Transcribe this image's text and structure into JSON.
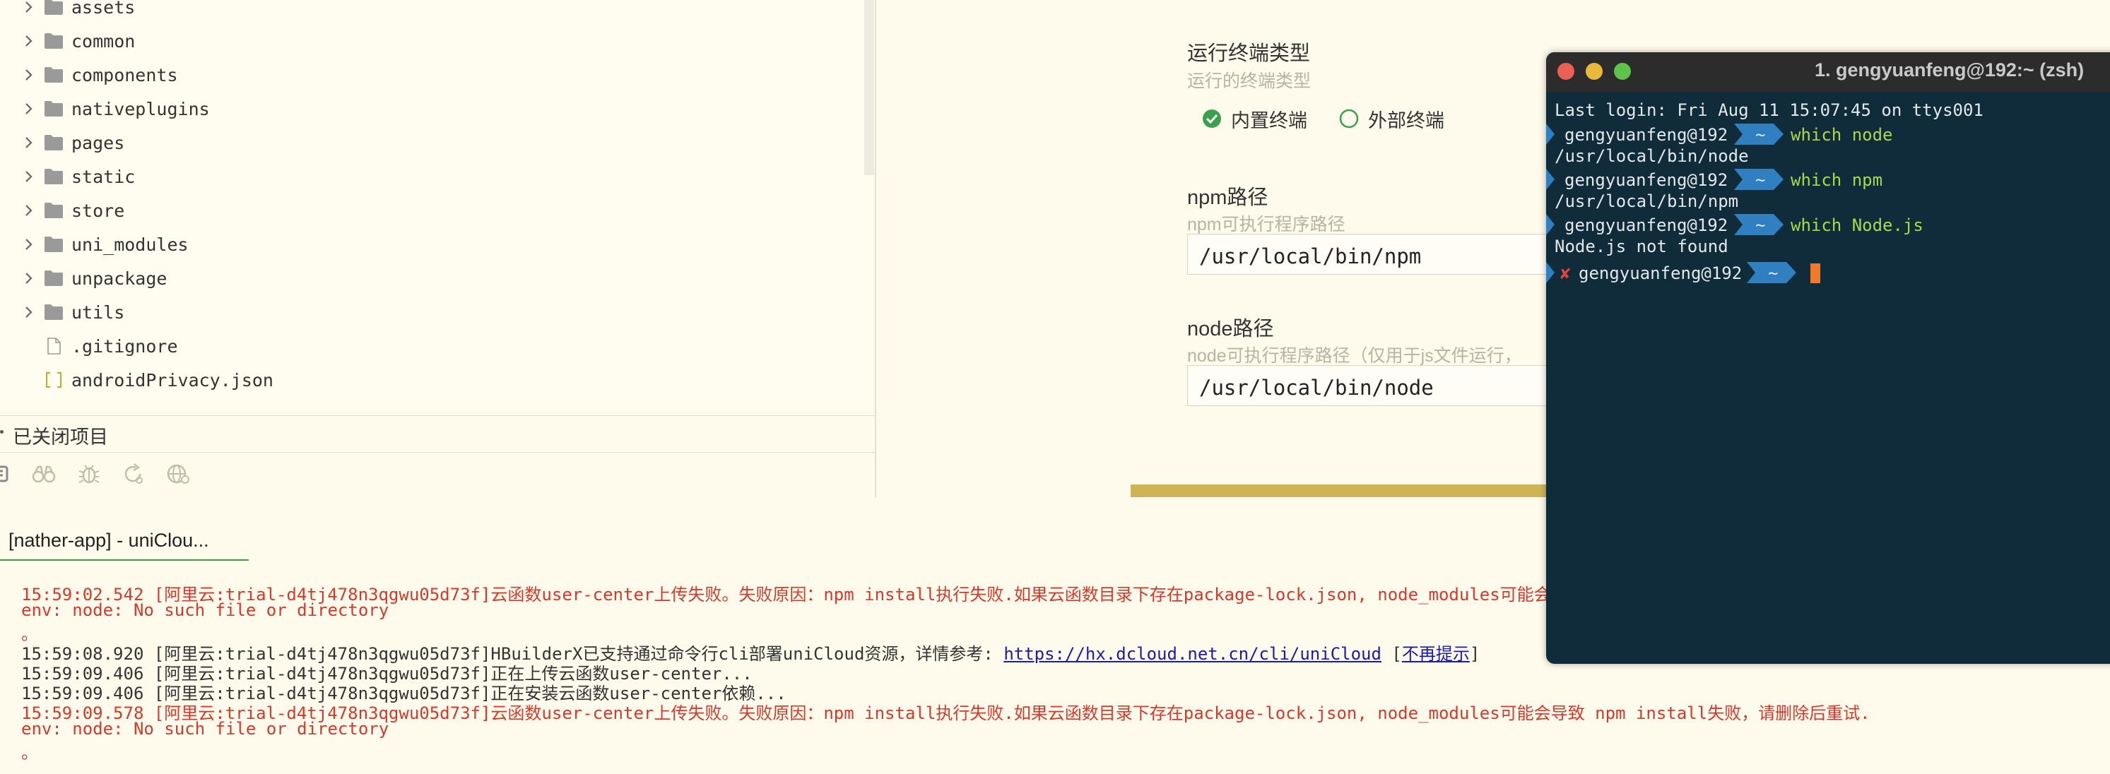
{
  "explorer": {
    "items": [
      {
        "label": "assets",
        "type": "folder"
      },
      {
        "label": "common",
        "type": "folder"
      },
      {
        "label": "components",
        "type": "folder"
      },
      {
        "label": "nativeplugins",
        "type": "folder"
      },
      {
        "label": "pages",
        "type": "folder"
      },
      {
        "label": "static",
        "type": "folder"
      },
      {
        "label": "store",
        "type": "folder"
      },
      {
        "label": "uni_modules",
        "type": "folder"
      },
      {
        "label": "unpackage",
        "type": "folder"
      },
      {
        "label": "utils",
        "type": "folder"
      },
      {
        "label": ".gitignore",
        "type": "file"
      },
      {
        "label": "androidPrivacy.json",
        "type": "json"
      }
    ],
    "closed_projects_label": "已关闭项目",
    "toolbar_icons": [
      "list-icon",
      "binoculars-icon",
      "bug-icon",
      "refresh-icon",
      "globe-icon"
    ]
  },
  "settings": {
    "terminal_type": {
      "title": "运行终端类型",
      "desc": "运行的终端类型",
      "options": [
        {
          "label": "内置终端",
          "checked": true
        },
        {
          "label": "外部终端",
          "checked": false
        }
      ]
    },
    "npm_path": {
      "title": "npm路径",
      "desc": "npm可执行程序路径",
      "value": "/usr/local/bin/npm"
    },
    "node_path": {
      "title": "node路径",
      "desc": "node可执行程序路径（仅用于js文件运行，",
      "value": "/usr/local/bin/node"
    }
  },
  "console": {
    "tab_label": "[nather-app] - uniClou...",
    "lines": [
      {
        "text": "15:59:02.542 [阿里云:trial-d4tj478n3qgwu05d73f]云函数user-center上传失败。失败原因：npm install执行失败.如果云函数目录下存在package-lock.json, node_modules可能会",
        "kind": "err"
      },
      {
        "text": "env: node: No such file or directory",
        "kind": "err"
      },
      {
        "text": "。",
        "kind": "err"
      },
      {
        "text_before": "15:59:08.920 [阿里云:trial-d4tj478n3qgwu05d73f]HBuilderX已支持通过命令行cli部署uniCloud资源，详情参考: ",
        "link": "https://hx.dcloud.net.cn/cli/uniCloud",
        "text_mid": " [",
        "link2": "不再提示",
        "text_after": "]",
        "kind": "info"
      },
      {
        "text": "15:59:09.406 [阿里云:trial-d4tj478n3qgwu05d73f]正在上传云函数user-center...",
        "kind": "info"
      },
      {
        "text": "15:59:09.406 [阿里云:trial-d4tj478n3qgwu05d73f]正在安装云函数user-center依赖...",
        "kind": "info"
      },
      {
        "text": "15:59:09.578 [阿里云:trial-d4tj478n3qgwu05d73f]云函数user-center上传失败。失败原因：npm install执行失败.如果云函数目录下存在package-lock.json, node_modules可能会导致 npm install失败，请删除后重试.",
        "kind": "err"
      },
      {
        "text": "env: node: No such file or directory",
        "kind": "err"
      },
      {
        "text": "。",
        "kind": "err"
      }
    ]
  },
  "terminal": {
    "title": "1. gengyuanfeng@192:~ (zsh)",
    "last_login": "Last login: Fri Aug 11 15:07:45 on ttys001",
    "host": "gengyuanfeng@192",
    "dir": "~",
    "entries": [
      {
        "cmd": "which node",
        "output": "/usr/local/bin/node"
      },
      {
        "cmd": "which npm",
        "output": "/usr/local/bin/npm"
      },
      {
        "cmd": "which Node.js",
        "output": "Node.js not found"
      }
    ],
    "error_mark": "✘",
    "colors": {
      "bg": "#102b3a",
      "command": "#a9d84a",
      "segment": "#2f7fc1",
      "cursor": "#f07a28",
      "error": "#e0443a"
    }
  },
  "colors": {
    "page_bg": "#fffbec",
    "error_text": "#d13b2e",
    "link": "#1b1ba7",
    "folder_icon": "#9a9a9a",
    "radio_checked": "#3aa04a",
    "accent_bar": "#cfb457"
  }
}
